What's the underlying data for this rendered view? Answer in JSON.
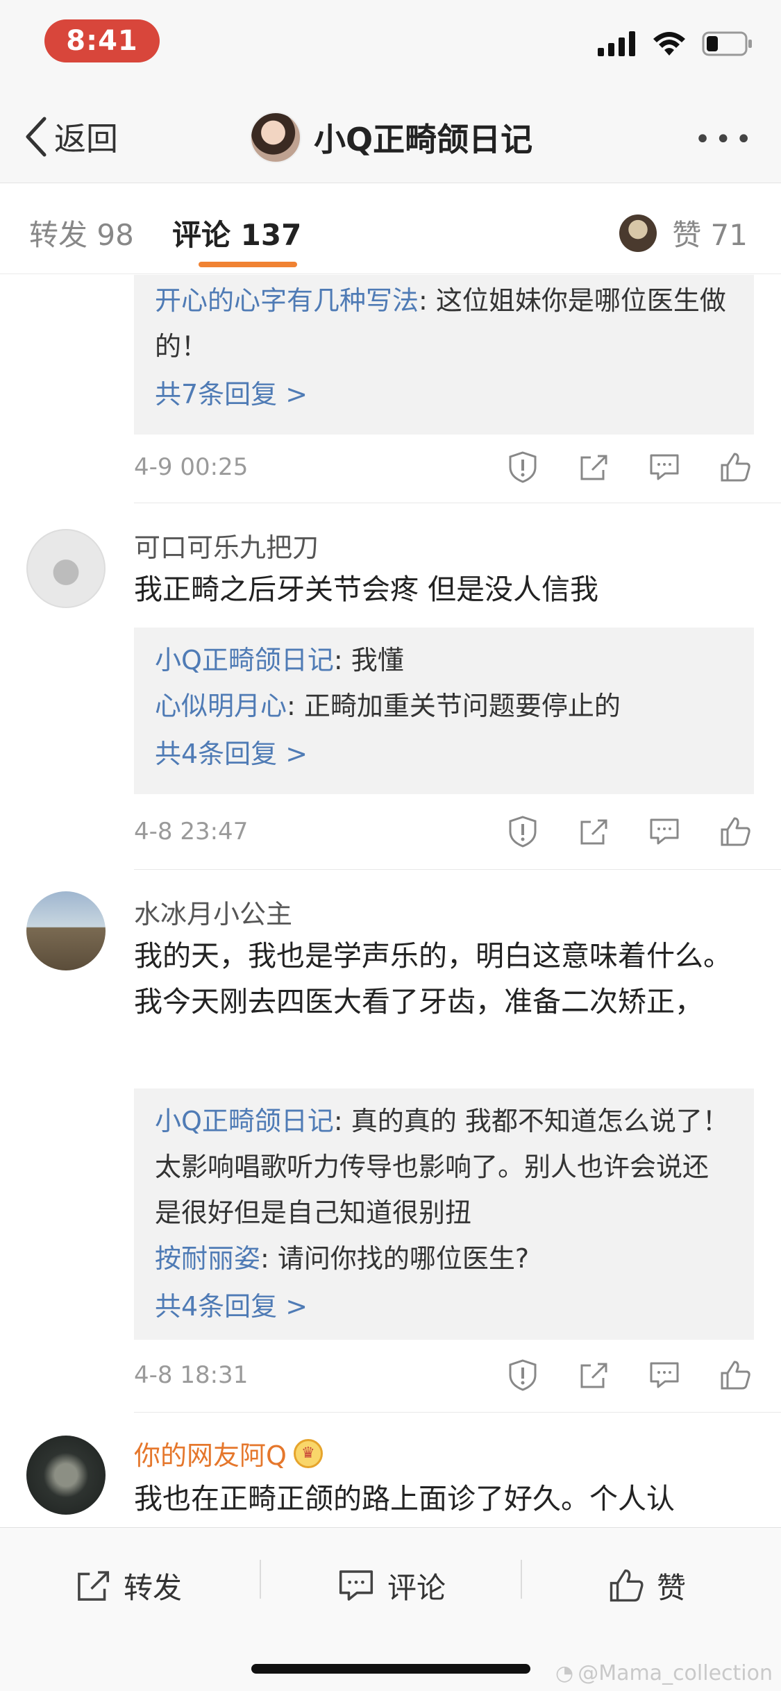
{
  "status_bar": {
    "time": "8:41"
  },
  "nav": {
    "back_label": "返回",
    "title": "小Q正畸颌日记",
    "more": "•••"
  },
  "tabs": {
    "repost": "转发 98",
    "comment": "评论 137",
    "like": "赞 71"
  },
  "thread0": {
    "reply_author": "开心的心字有几种写法",
    "reply_text": ": 这位姐妹你是哪位医生做的！",
    "more": "共7条回复 >",
    "time": "4-9 00:25"
  },
  "comments": [
    {
      "author": "可口可乐九把刀",
      "text": "我正畸之后牙关节会疼 但是没人信我",
      "replies": [
        {
          "author": "小Q正畸颌日记",
          "text": ": 我懂"
        },
        {
          "author": "心似明月心",
          "text": ": 正畸加重关节问题要停止的"
        }
      ],
      "more": "共4条回复 >",
      "time": "4-8 23:47"
    },
    {
      "author": "水冰月小公主",
      "text": "我的天，我也是学声乐的，明白这意味着什么。我今天刚去四医大看了牙齿，准备二次矫正，",
      "replies": [
        {
          "author": "小Q正畸颌日记",
          "text": ": 真的真的 我都不知道怎么说了！ 太影响唱歌听力传导也影响了。别人也许会说还是很好但是自己知道很别扭"
        },
        {
          "author": "按耐丽姿",
          "text": ": 请问你找的哪位医生?"
        }
      ],
      "more": "共4条回复 >",
      "time": "4-8 18:31"
    },
    {
      "author": "你的网友阿Q",
      "text": "我也在正畸正颌的路上面诊了好久。个人认"
    }
  ],
  "bottom": {
    "repost": "转发",
    "comment": "评论",
    "like": "赞"
  },
  "watermark": "@Mama_collection",
  "colors": {
    "accent": "#f08232",
    "link": "#4f7bb5",
    "time_pill": "#d8463b",
    "vip": "#e5772c"
  }
}
